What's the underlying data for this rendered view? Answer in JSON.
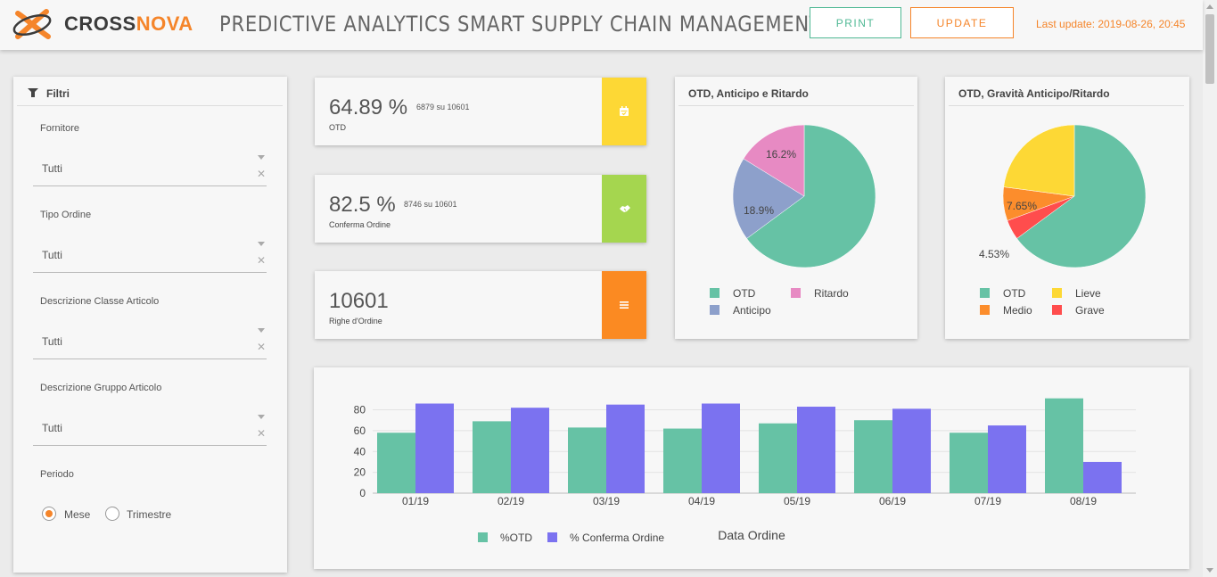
{
  "header": {
    "brand_part1": "CROSS",
    "brand_part2": "NOVA",
    "title": "PREDICTIVE ANALYTICS SMART SUPPLY CHAIN MANAGEMENT",
    "print_label": "PRINT",
    "update_label": "UPDATE",
    "last_update": "Last update: 2019-08-26, 20:45"
  },
  "filters": {
    "title": "Filtri",
    "fields": [
      {
        "label": "Fornitore",
        "value": "Tutti"
      },
      {
        "label": "Tipo Ordine",
        "value": "Tutti"
      },
      {
        "label": "Descrizione Classe Articolo",
        "value": "Tutti"
      },
      {
        "label": "Descrizione Gruppo Articolo",
        "value": "Tutti"
      }
    ],
    "period_label": "Periodo",
    "period_options": [
      "Mese",
      "Trimestre"
    ],
    "period_selected": "Mese"
  },
  "kpis": [
    {
      "value": "64.89 %",
      "sub": "6879 su 10601",
      "label": "OTD",
      "color": "#fdd835",
      "icon": "calendar-icon"
    },
    {
      "value": "82.5 %",
      "sub": "8746 su 10601",
      "label": "Conferma Ordine",
      "color": "#a5d64f",
      "icon": "handshake-icon"
    },
    {
      "value": "10601",
      "sub": "",
      "label": "Righe d'Ordine",
      "color": "#fb8a22",
      "icon": "list-icon"
    }
  ],
  "colors": {
    "accent": "#f5852a",
    "teal": "#4fb894",
    "otd": "#66c2a5",
    "anticipo": "#8da0cb",
    "ritardo": "#e78ac3",
    "medio": "#fc8d2c",
    "lieve": "#fdd835",
    "grave": "#ff4d4d",
    "conferma": "#7b72f0"
  },
  "chart_data": [
    {
      "type": "pie",
      "title": "OTD, Anticipo e Ritardo",
      "slices": [
        {
          "label": "OTD",
          "value": 64.9,
          "color": "#66c2a5"
        },
        {
          "label": "Anticipo",
          "value": 18.9,
          "color": "#8da0cb"
        },
        {
          "label": "Ritardo",
          "value": 16.2,
          "color": "#e78ac3"
        }
      ],
      "data_labels": [
        "16.2%",
        "18.9%"
      ],
      "legend": [
        "OTD",
        "Ritardo",
        "Anticipo"
      ]
    },
    {
      "type": "pie",
      "title": "OTD, Gravità Anticipo/Ritardo",
      "slices": [
        {
          "label": "OTD",
          "value": 64.9,
          "color": "#66c2a5"
        },
        {
          "label": "Grave",
          "value": 4.53,
          "color": "#ff4d4d"
        },
        {
          "label": "Medio",
          "value": 7.65,
          "color": "#fc8d2c"
        },
        {
          "label": "Lieve",
          "value": 22.92,
          "color": "#fdd835"
        }
      ],
      "data_labels": [
        "7.65%",
        "4.53%"
      ],
      "legend": [
        "OTD",
        "Lieve",
        "Medio",
        "Grave"
      ]
    },
    {
      "type": "bar",
      "categories": [
        "01/19",
        "02/19",
        "03/19",
        "04/19",
        "05/19",
        "06/19",
        "07/19",
        "08/19"
      ],
      "series": [
        {
          "name": "%OTD",
          "values": [
            58,
            69,
            63,
            62,
            67,
            70,
            58,
            91
          ],
          "color": "#66c2a5"
        },
        {
          "name": "% Conferma Ordine",
          "values": [
            86,
            82,
            85,
            86,
            83,
            81,
            65,
            30
          ],
          "color": "#7b72f0"
        }
      ],
      "xlabel": "Data Ordine",
      "ylabel": "",
      "yticks": [
        0,
        20,
        40,
        60,
        80
      ],
      "ylim": [
        0,
        95
      ],
      "grid": true
    }
  ]
}
